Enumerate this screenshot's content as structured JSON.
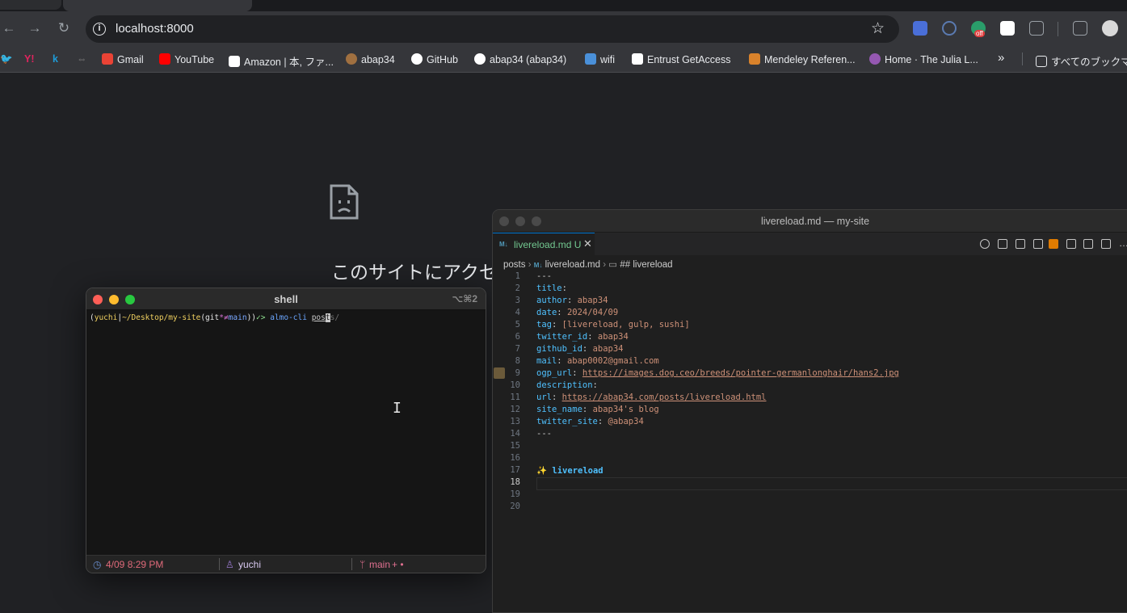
{
  "browser": {
    "url": "localhost:8000",
    "ext_badge": "off",
    "bookmarks": [
      {
        "label": "Gmail",
        "icon": "gmail-icon",
        "color": "#ea4335"
      },
      {
        "label": "YouTube",
        "icon": "youtube-icon",
        "color": "#ff0000"
      },
      {
        "label": "Amazon | 本, ファ...",
        "icon": "amazon-icon",
        "color": "#ffffff"
      },
      {
        "label": "abap34",
        "icon": "abap34-icon",
        "color": "#a07040"
      },
      {
        "label": "GitHub",
        "icon": "github-icon",
        "color": "#ffffff"
      },
      {
        "label": "abap34 (abap34)",
        "icon": "github-icon",
        "color": "#ffffff"
      },
      {
        "label": "wifi",
        "icon": "wifi-icon",
        "color": "#4a90d9"
      },
      {
        "label": "Entrust GetAccess",
        "icon": "entrust-icon",
        "color": "#ffffff"
      },
      {
        "label": "Mendeley Referen...",
        "icon": "mendeley-icon",
        "color": "#d9822b"
      },
      {
        "label": "Home · The Julia L...",
        "icon": "julia-icon",
        "color": "#9558b2"
      }
    ],
    "all_bookmarks": "すべてのブックマ"
  },
  "page": {
    "error_text": "このサイトにアクセ"
  },
  "terminal": {
    "title": "shell",
    "shortcut": "⌥⌘2",
    "prompt_user": "yuchi",
    "prompt_path": "~/Desktop/my-site",
    "prompt_git": "git",
    "prompt_branch": "main",
    "prompt_ok": "✓>",
    "command": "almo-cli",
    "arg_typed": "pos",
    "arg_cursor": "t",
    "arg_rest": "s/",
    "status_time": "4/09 8:29 PM",
    "status_user": "yuchi",
    "status_branch": "main"
  },
  "editor": {
    "window_title": "livereload.md — my-site",
    "tab_label": "livereload.md",
    "tab_status": "U",
    "crumb_folder": "posts",
    "crumb_file": "livereload.md",
    "crumb_symbol": "## livereload",
    "lines": [
      {
        "n": "1",
        "key": "",
        "val": "---"
      },
      {
        "n": "2",
        "key": "title",
        "val": ""
      },
      {
        "n": "3",
        "key": "author",
        "val": "abap34"
      },
      {
        "n": "4",
        "key": "date",
        "val": "2024/04/09"
      },
      {
        "n": "5",
        "key": "tag",
        "val": "[livereload, gulp, sushi]"
      },
      {
        "n": "6",
        "key": "twitter_id",
        "val": "abap34"
      },
      {
        "n": "7",
        "key": "github_id",
        "val": "abap34"
      },
      {
        "n": "8",
        "key": "mail",
        "val": "abap0002@gmail.com"
      },
      {
        "n": "9",
        "key": "ogp_url",
        "val": "https://images.dog.ceo/breeds/pointer-germanlonghair/hans2.jpg"
      },
      {
        "n": "10",
        "key": "description",
        "val": ""
      },
      {
        "n": "11",
        "key": "url",
        "val": "https://abap34.com/posts/livereload.html"
      },
      {
        "n": "12",
        "key": "site_name",
        "val": "abap34's blog"
      },
      {
        "n": "13",
        "key": "twitter_site",
        "val": "@abap34"
      },
      {
        "n": "14",
        "key": "",
        "val": "---"
      },
      {
        "n": "15",
        "key": "",
        "val": ""
      },
      {
        "n": "16",
        "key": "",
        "val": ""
      },
      {
        "n": "17",
        "key": "",
        "val": "livereload"
      },
      {
        "n": "18",
        "key": "",
        "val": ""
      },
      {
        "n": "19",
        "key": "",
        "val": ""
      },
      {
        "n": "20",
        "key": "",
        "val": ""
      }
    ]
  }
}
